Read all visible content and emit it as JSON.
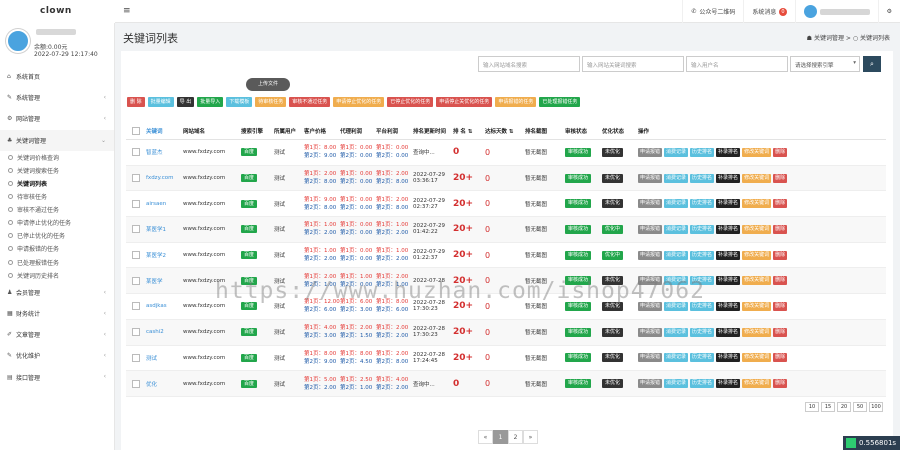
{
  "app": {
    "logo": "clown"
  },
  "topbar": {
    "menu_icon": "≡",
    "wechat": "公众号二维码",
    "msg": "系统消息",
    "msg_count": "0"
  },
  "user": {
    "balance": "余额:0.00元",
    "time": "2022-07-29 12:17:40"
  },
  "nav": [
    {
      "icon": "⌂",
      "label": "系统首页",
      "arrow": ""
    },
    {
      "icon": "✎",
      "label": "系统管理",
      "arrow": "‹"
    },
    {
      "icon": "⚙",
      "label": "网站管理",
      "arrow": "‹"
    },
    {
      "icon": "♣",
      "label": "关键词管理",
      "arrow": "⌄"
    }
  ],
  "subnav": [
    "关键词价格查询",
    "关键词搜索任务",
    "关键词列表",
    "待审核任务",
    "审核不通过任务",
    "申请停止优化的任务",
    "已停止优化的任务",
    "申请报错的任务",
    "已处理报错任务",
    "关键词历史排名"
  ],
  "nav2": [
    {
      "icon": "♟",
      "label": "会员管理",
      "arrow": "‹"
    },
    {
      "icon": "▦",
      "label": "财务统计",
      "arrow": "‹"
    },
    {
      "icon": "✐",
      "label": "文章管理",
      "arrow": "‹"
    },
    {
      "icon": "✎",
      "label": "优化维护",
      "arrow": "‹"
    },
    {
      "icon": "▤",
      "label": "接口管理",
      "arrow": "‹"
    }
  ],
  "page": {
    "title": "关键词列表",
    "crumb1": "关键词管理",
    "crumb_sep": ">",
    "crumb2": "关键词列表"
  },
  "search": {
    "ph1": "输入网站域名搜索",
    "ph2": "输入网站关键词搜索",
    "ph3": "输入用户名",
    "select": "请选择搜索引擎"
  },
  "upload": "上传文件",
  "toolbar": [
    {
      "label": "删 除",
      "color": "#d9534f"
    },
    {
      "label": "批量编辑",
      "color": "#5bc0de"
    },
    {
      "label": "导 出",
      "color": "#333333"
    },
    {
      "label": "批量导入",
      "color": "#22a64b"
    },
    {
      "label": "下载模板",
      "color": "#5bc0de"
    },
    {
      "label": "待审核任务",
      "color": "#f0ad4e"
    },
    {
      "label": "审核不通过任务",
      "color": "#d9534f"
    },
    {
      "label": "申请停止优化的任务",
      "color": "#f0ad4e"
    },
    {
      "label": "已停止优化的任务",
      "color": "#d9534f"
    },
    {
      "label": "申请停止关优化的任务",
      "color": "#d9534f"
    },
    {
      "label": "申请报错的任务",
      "color": "#f0ad4e"
    },
    {
      "label": "已处理报错任务",
      "color": "#22a64b"
    }
  ],
  "headers": [
    "",
    "关键词",
    "网站域名",
    "搜索引擎",
    "所属用户",
    "客户价格",
    "代理利润",
    "平台利润",
    "排名更新时间",
    "排 名 ⇅",
    "达标天数 ⇅",
    "排名截图",
    "审核状态",
    "优化状态",
    "操作"
  ],
  "rows": [
    {
      "kw": "智蓝杰",
      "domain": "www.fxdzy.com",
      "engine": "百度",
      "user": "测试",
      "cp1": "第1页：8.00",
      "cp2": "第2页：9.00",
      "ap1": "第1页：0.00",
      "ap2": "第2页：0.00",
      "pp1": "第1页：0.00",
      "pp2": "第2页：0.00",
      "time1": "查询中...",
      "time2": "",
      "rank": "0",
      "days": "0",
      "shot": "暂无截图",
      "audit": "审核成功",
      "opt": "未优化",
      "opt_style": "b"
    },
    {
      "kw": "fxdzy.com",
      "domain": "www.fxdzy.com",
      "engine": "百度",
      "user": "测试",
      "cp1": "第1页：2.00",
      "cp2": "第2页：8.00",
      "ap1": "第1页：0.00",
      "ap2": "第2页：0.00",
      "pp1": "第1页：2.00",
      "pp2": "第2页：8.00",
      "time1": "2022-07-29",
      "time2": "03:36:17",
      "rank": "20+",
      "days": "0",
      "shot": "暂无截图",
      "audit": "审核成功",
      "opt": "未优化",
      "opt_style": "b"
    },
    {
      "kw": "airsaen",
      "domain": "www.fxdzy.com",
      "engine": "百度",
      "user": "测试",
      "cp1": "第1页：9.00",
      "cp2": "第2页：8.00",
      "ap1": "第1页：0.00",
      "ap2": "第2页：0.00",
      "pp1": "第1页：2.00",
      "pp2": "第2页：8.00",
      "time1": "2022-07-29",
      "time2": "02:37:27",
      "rank": "20+",
      "days": "0",
      "shot": "暂无截图",
      "audit": "审核成功",
      "opt": "未优化",
      "opt_style": "b"
    },
    {
      "kw": "某医学1",
      "domain": "www.fxdzy.com",
      "engine": "百度",
      "user": "测试",
      "cp1": "第1页：1.00",
      "cp2": "第2页：2.00",
      "ap1": "第1页：0.00",
      "ap2": "第2页：0.00",
      "pp1": "第1页：1.00",
      "pp2": "第2页：2.00",
      "time1": "2022-07-29",
      "time2": "01:42:22",
      "rank": "20+",
      "days": "0",
      "shot": "暂无截图",
      "audit": "审核成功",
      "opt": "优化中",
      "opt_style": "a"
    },
    {
      "kw": "某医学2",
      "domain": "www.fxdzy.com",
      "engine": "百度",
      "user": "测试",
      "cp1": "第1页：1.00",
      "cp2": "第2页：2.00",
      "ap1": "第1页：0.00",
      "ap2": "第2页：0.00",
      "pp1": "第1页：1.00",
      "pp2": "第2页：2.00",
      "time1": "2022-07-29",
      "time2": "01:22:37",
      "rank": "20+",
      "days": "0",
      "shot": "暂无截图",
      "audit": "审核成功",
      "opt": "优化中",
      "opt_style": "a"
    },
    {
      "kw": "某医学",
      "domain": "www.fxdzy.com",
      "engine": "百度",
      "user": "测试",
      "cp1": "第1页：2.00",
      "cp2": "第2页：1.00",
      "ap1": "第1页：1.00",
      "ap2": "第2页：0.00",
      "pp1": "第1页：2.00",
      "pp2": "第2页：1.00",
      "time1": "2022-07-28",
      "time2": "",
      "rank": "20+",
      "days": "0",
      "shot": "暂无截图",
      "audit": "审核成功",
      "opt": "未优化",
      "opt_style": "b"
    },
    {
      "kw": "asdjkas",
      "domain": "www.fxdzy.com",
      "engine": "百度",
      "user": "测试",
      "cp1": "第1页：12.00",
      "cp2": "第2页：6.00",
      "ap1": "第1页：6.00",
      "ap2": "第2页：3.00",
      "pp1": "第1页：8.00",
      "pp2": "第2页：6.00",
      "time1": "2022-07-28",
      "time2": "17:30:23",
      "rank": "20+",
      "days": "0",
      "shot": "暂无截图",
      "audit": "审核成功",
      "opt": "未优化",
      "opt_style": "b"
    },
    {
      "kw": "cashi2",
      "domain": "www.fxdzy.com",
      "engine": "百度",
      "user": "测试",
      "cp1": "第1页：4.00",
      "cp2": "第2页：3.00",
      "ap1": "第1页：2.00",
      "ap2": "第2页：1.50",
      "pp1": "第1页：2.00",
      "pp2": "第2页：2.00",
      "time1": "2022-07-28",
      "time2": "17:30:23",
      "rank": "20+",
      "days": "0",
      "shot": "暂无截图",
      "audit": "审核成功",
      "opt": "未优化",
      "opt_style": "b"
    },
    {
      "kw": "测试",
      "domain": "www.fxdzy.com",
      "engine": "百度",
      "user": "测试",
      "cp1": "第1页：8.00",
      "cp2": "第2页：9.00",
      "ap1": "第1页：8.00",
      "ap2": "第2页：4.50",
      "pp1": "第1页：2.00",
      "pp2": "第2页：8.00",
      "time1": "2022-07-28",
      "time2": "17:24:45",
      "rank": "20+",
      "days": "0",
      "shot": "暂无截图",
      "audit": "审核成功",
      "opt": "未优化",
      "opt_style": "b"
    },
    {
      "kw": "优化",
      "domain": "www.fxdzy.com",
      "engine": "百度",
      "user": "测试",
      "cp1": "第1页：5.00",
      "cp2": "第2页：2.00",
      "ap1": "第1页：2.50",
      "ap2": "第2页：1.00",
      "pp1": "第1页：4.00",
      "pp2": "第2页：2.00",
      "time1": "查询中...",
      "time2": "",
      "rank": "0",
      "days": "0",
      "shot": "暂无截图",
      "audit": "审核成功",
      "opt": "未优化",
      "opt_style": "b"
    }
  ],
  "row_actions": [
    {
      "label": "申请报错",
      "color": "#8a8a8a"
    },
    {
      "label": "消费记录",
      "color": "#5bc0de"
    },
    {
      "label": "历史排名",
      "color": "#5bc0de"
    },
    {
      "label": "补录排名",
      "color": "#222222"
    },
    {
      "label": "修改关键词",
      "color": "#f0ad4e"
    },
    {
      "label": "删除",
      "color": "#d9534f"
    }
  ],
  "page_sizes": [
    "10",
    "15",
    "20",
    "50",
    "100"
  ],
  "pager": [
    "«",
    "1",
    "2",
    "»"
  ],
  "watermark": "https://www.huzhan.com/ishop47062",
  "timer": "0.556801s"
}
